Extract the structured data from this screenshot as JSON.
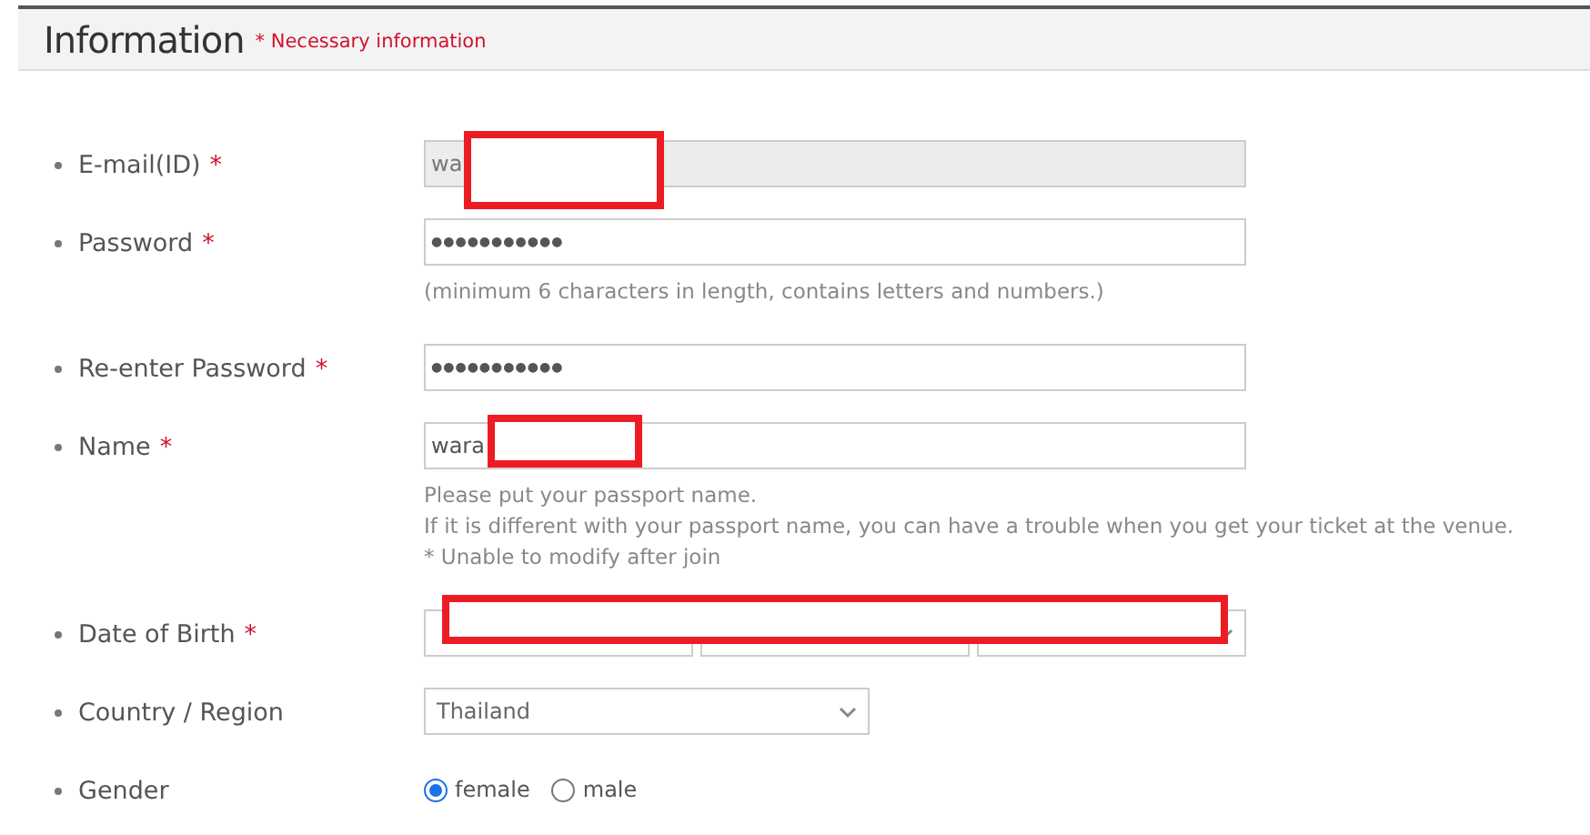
{
  "section": {
    "title": "Information",
    "note": "* Necessary information"
  },
  "fields": [
    {
      "kind": "text",
      "label": "E-mail(ID)",
      "required_mark": "*",
      "value": "wa",
      "disabled": true,
      "redacted": true
    },
    {
      "kind": "password",
      "label": "Password",
      "required_mark": "*",
      "value": "●●●●●●●●●●●",
      "disabled": false,
      "hints": [
        "(minimum 6 characters in length, contains letters and numbers.)"
      ]
    },
    {
      "kind": "password",
      "label": "Re-enter Password",
      "required_mark": "*",
      "value": "●●●●●●●●●●●",
      "disabled": false
    },
    {
      "kind": "text",
      "label": "Name",
      "required_mark": "*",
      "value": "wara",
      "disabled": false,
      "redacted": true,
      "hints": [
        "Please put your passport name.",
        "If it is different with your passport name, you can have a trouble when you get your ticket at the venue.",
        "* Unable to modify after join"
      ]
    },
    {
      "kind": "date",
      "label": "Date of Birth",
      "required_mark": "*",
      "redacted": true
    },
    {
      "kind": "select",
      "label": "Country / Region",
      "value": "Thailand"
    },
    {
      "kind": "radio",
      "label": "Gender",
      "options": [
        {
          "label": "female",
          "selected": true
        },
        {
          "label": "male",
          "selected": false
        }
      ]
    }
  ]
}
